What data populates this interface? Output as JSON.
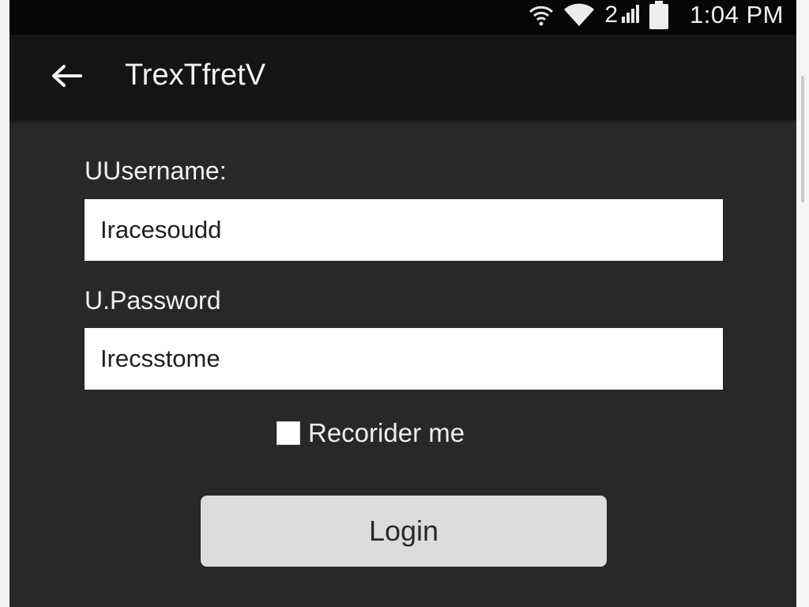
{
  "status_bar": {
    "signal_label": "2",
    "time": "1:04 PM",
    "icons": [
      "wifi-icon",
      "wifi-icon",
      "cell-signal-icon",
      "battery-icon"
    ]
  },
  "app_bar": {
    "back_icon": "arrow-left-icon",
    "title": "TrexTfretV"
  },
  "form": {
    "username_label": "UUsername:",
    "username_value": "Iracesoudd",
    "password_label": "U.Password",
    "password_value": "Irecsstome",
    "remember_label": "Recorider me",
    "remember_checked": false,
    "login_label": "Login"
  },
  "colors": {
    "background": "#282828",
    "status_bar": "#070707",
    "app_bar": "#141414",
    "field": "#ffffff",
    "button": "#dcdcdc"
  }
}
